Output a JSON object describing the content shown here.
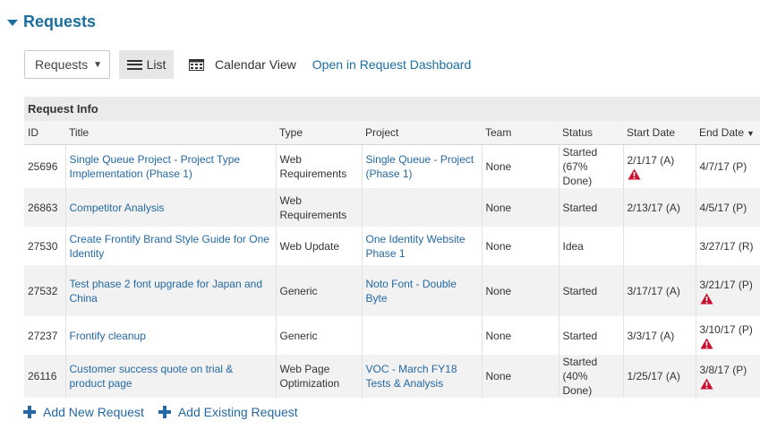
{
  "section": {
    "title": "Requests",
    "caret_icon": "caret-down-icon"
  },
  "toolbar": {
    "select_value": "Requests",
    "list_label": "List",
    "calendar_label": "Calendar View",
    "dashboard_link": "Open in Request Dashboard"
  },
  "table": {
    "group_title": "Request Info",
    "columns": [
      "ID",
      "Title",
      "Type",
      "Project",
      "Team",
      "Status",
      "Start Date",
      "End Date"
    ],
    "sort_icon": "sort-desc-icon",
    "rows": [
      {
        "id": "25696",
        "title": "Single Queue Project - Project Type Implementation (Phase 1)",
        "type": "Web Requirements",
        "project": "Single Queue - Project (Phase 1)",
        "team": "None",
        "status": "Started (67% Done)",
        "start": "2/1/17 (A)",
        "end": "4/7/17 (P)",
        "start_warning": true,
        "end_warning": false
      },
      {
        "id": "26863",
        "title": "Competitor Analysis",
        "type": "Web Requirements",
        "project": "",
        "team": "None",
        "status": "Started",
        "start": "2/13/17 (A)",
        "end": "4/5/17 (P)",
        "start_warning": false,
        "end_warning": false
      },
      {
        "id": "27530",
        "title": "Create Frontify Brand Style Guide for One Identity",
        "type": "Web Update",
        "project": "One Identity Website Phase 1",
        "team": "None",
        "status": "Idea",
        "start": "",
        "end": "3/27/17 (R)",
        "start_warning": false,
        "end_warning": false
      },
      {
        "id": "27532",
        "title": "Test phase 2 font upgrade for Japan and China",
        "type": "Generic",
        "project": "Noto Font - Double Byte",
        "team": "None",
        "status": "Started",
        "start": "3/17/17 (A)",
        "end": "3/21/17 (P)",
        "start_warning": false,
        "end_warning": true
      },
      {
        "id": "27237",
        "title": "Frontify cleanup",
        "type": "Generic",
        "project": "",
        "team": "None",
        "status": "Started",
        "start": "3/3/17 (A)",
        "end": "3/10/17 (P)",
        "start_warning": false,
        "end_warning": true
      },
      {
        "id": "26116",
        "title": "Customer success quote on trial & product page",
        "type": "Web Page Optimization",
        "project": "VOC - March FY18 Tests & Analysis",
        "team": "None",
        "status": "Started (40% Done)",
        "start": "1/25/17 (A)",
        "end": "3/8/17 (P)",
        "start_warning": false,
        "end_warning": true
      }
    ]
  },
  "footer": {
    "add_new_label": "Add New Request",
    "add_existing_label": "Add Existing Request"
  },
  "colors": {
    "accent": "#1a6fa0",
    "link": "#2469a3",
    "warning": "#c8102e"
  }
}
